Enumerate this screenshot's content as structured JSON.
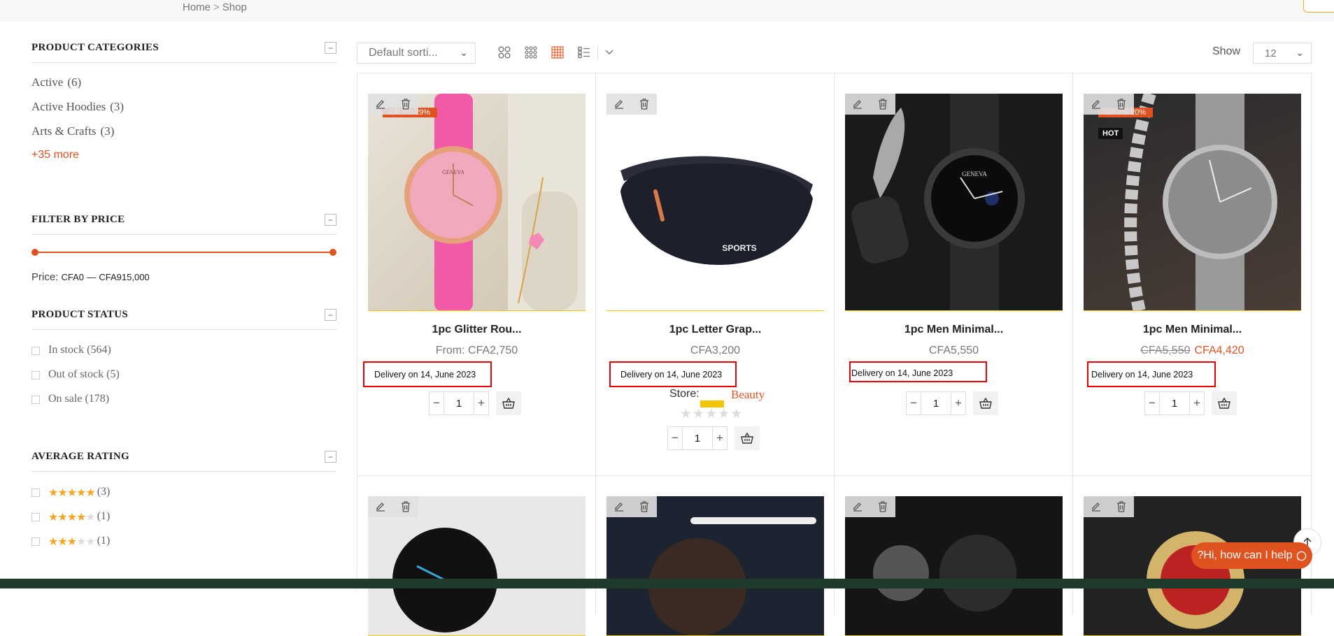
{
  "breadcrumb": {
    "home": "Home",
    "sep": ">",
    "current": "Shop"
  },
  "sidebar": {
    "categories": {
      "title": "PRODUCT CATEGORIES",
      "items": [
        {
          "label": "Active",
          "count": "(6)"
        },
        {
          "label": "Active Hoodies",
          "count": "(3)"
        },
        {
          "label": "Arts & Crafts",
          "count": "(3)"
        }
      ],
      "more": "+35 more"
    },
    "price": {
      "title": "FILTER BY PRICE",
      "label": "Price:",
      "min": "CFA0",
      "dash": "—",
      "max": "CFA915,000",
      "range_fraction": [
        0,
        1
      ]
    },
    "status": {
      "title": "PRODUCT STATUS",
      "items": [
        {
          "label": "In stock",
          "count": "(564)"
        },
        {
          "label": "Out of stock",
          "count": "(5)"
        },
        {
          "label": "On sale",
          "count": "(178)"
        }
      ]
    },
    "rating": {
      "title": "AVERAGE RATING",
      "items": [
        {
          "stars": 5,
          "count": "(3)"
        },
        {
          "stars": 4,
          "count": "(1)"
        },
        {
          "stars": 3,
          "count": "(1)"
        }
      ]
    },
    "collapse_symbol": "−"
  },
  "toolbar": {
    "sort_value": "Default sorti...",
    "show_label": "Show",
    "show_value": "12",
    "active_view": "grid-4-icon"
  },
  "products": [
    {
      "title": "1pc Glitter Rou...",
      "price_prefix": "From:",
      "price": "CFA2,750",
      "delivery": "Delivery on 14, June 2023",
      "qty": "1",
      "badge": "UP TO 29%"
    },
    {
      "title": "1pc Letter Grap...",
      "price": "CFA3,200",
      "delivery": "Delivery on 14, June 2023",
      "qty": "1",
      "store_label": "Store:",
      "store_name": "Beauty"
    },
    {
      "title": "1pc Men Minimal...",
      "price": "CFA5,550",
      "delivery": "Delivery on 14, June 2023",
      "qty": "1"
    },
    {
      "title": "1pc Men Minimal...",
      "price_old": "CFA5,550",
      "price_new": "CFA4,420",
      "delivery": "Delivery on 14, June 2023",
      "qty": "1",
      "badge": "UP TO 20%",
      "hot": "HOT"
    }
  ],
  "bag_text": "SPORTS",
  "watch_brand": "GENEVA",
  "chat": {
    "label": "?Hi, how can I help"
  },
  "colors": {
    "accent": "#e0521f",
    "highlight": "#f5c400",
    "delivery_border": "#ee0000"
  }
}
